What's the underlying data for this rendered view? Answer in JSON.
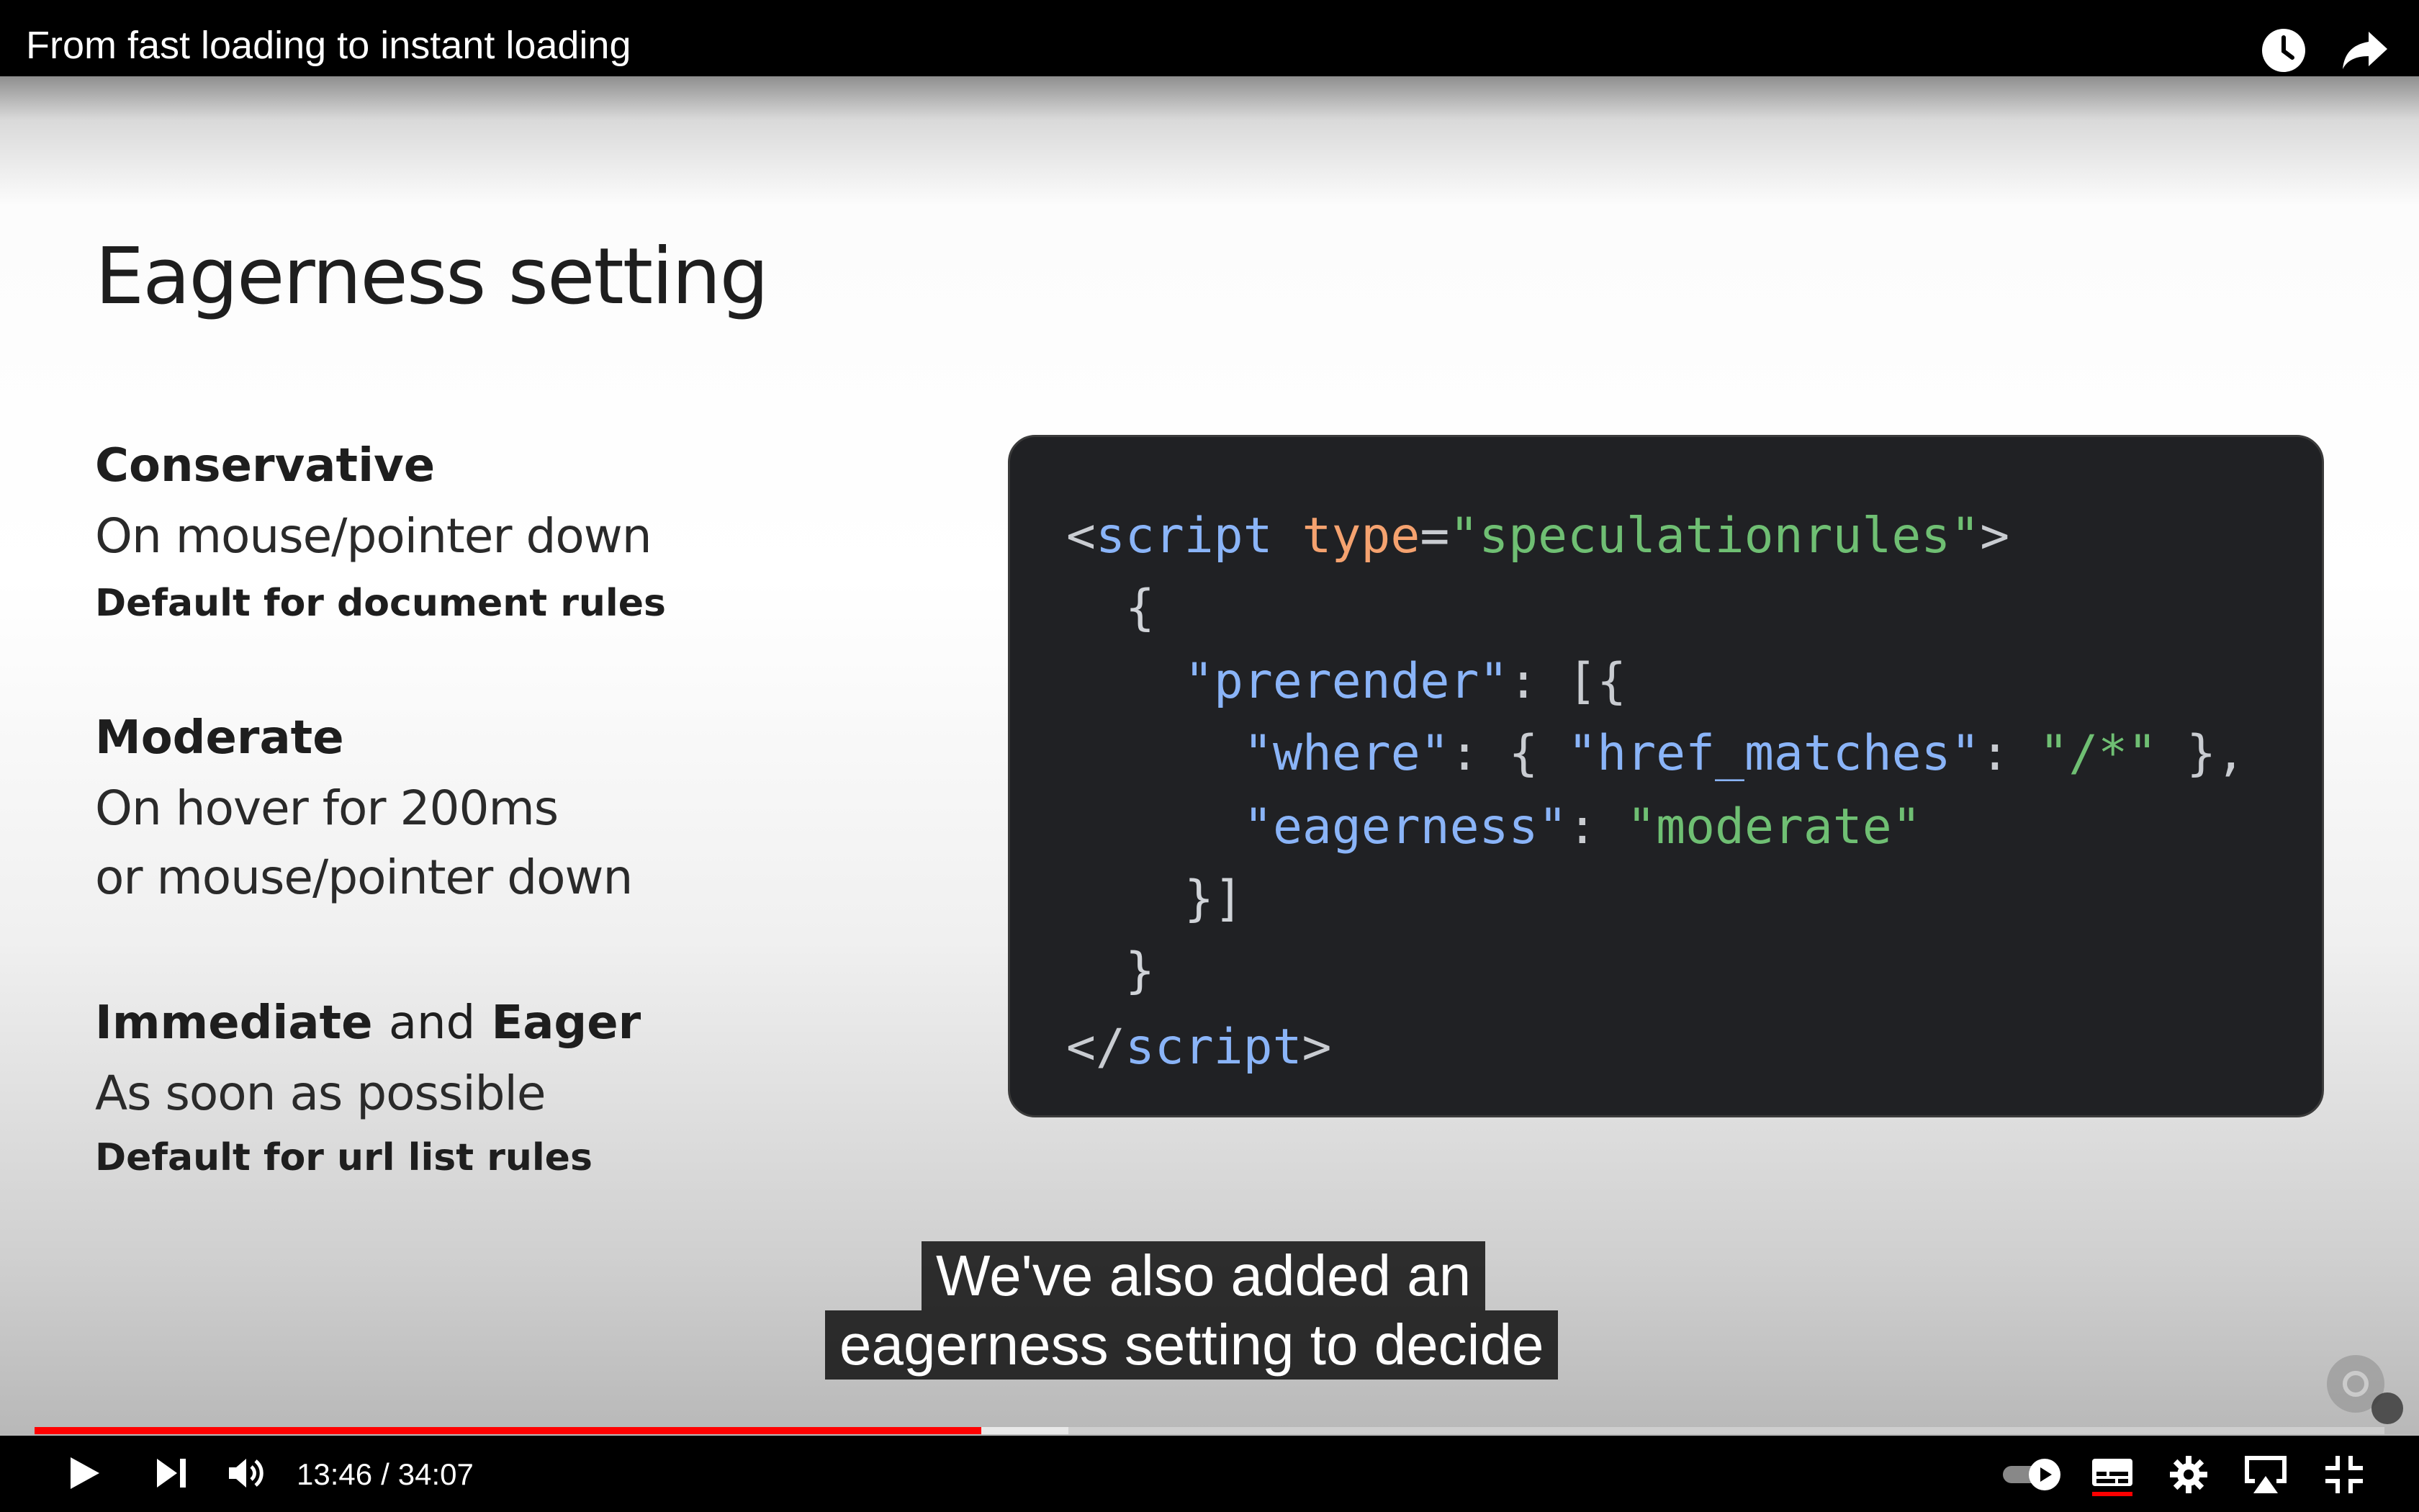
{
  "video": {
    "title": "From fast loading to instant loading",
    "current_time": "13:46",
    "duration": "34:07",
    "progress": 0.403,
    "buffered": 0.44
  },
  "slide": {
    "title": "Eagerness setting",
    "sections": [
      {
        "heading": "Conservative",
        "lines": [
          "On mouse/pointer down"
        ],
        "note": "Default for document rules"
      },
      {
        "heading": "Moderate",
        "lines": [
          "On hover for 200ms",
          "or mouse/pointer down"
        ],
        "note": ""
      },
      {
        "heading_a": "Immediate",
        "heading_and": "and",
        "heading_b": "Eager",
        "lines": [
          "As soon as possible"
        ],
        "note": "Default for url list rules"
      }
    ],
    "code": {
      "l1_open": "<",
      "l1_tag": "script",
      "l1_attr": "type",
      "l1_eq": "=",
      "l1_val": "\"speculationrules\"",
      "l1_close": ">",
      "l2": "{",
      "l3_key": "\"prerender\"",
      "l3_rest": ": [{",
      "l4_key": "\"where\"",
      "l4_mid": ": { ",
      "l4_key2": "\"href_matches\"",
      "l4_colon": ": ",
      "l4_val": "\"/*\"",
      "l4_end": " },",
      "l5_key": "\"eagerness\"",
      "l5_colon": ": ",
      "l5_val": "\"moderate\"",
      "l6": "}]",
      "l7": "}",
      "l8_open": "</",
      "l8_tag": "script",
      "l8_close": ">"
    }
  },
  "captions": {
    "line1": "We've also added an",
    "line2": "eagerness setting to decide"
  },
  "icons": {
    "top": [
      "clock-icon",
      "share-icon"
    ],
    "controls": [
      "play-icon",
      "next-icon",
      "volume-icon",
      "autoplay-toggle-icon",
      "subtitles-icon",
      "settings-icon",
      "airplay-icon",
      "exit-fullscreen-icon"
    ]
  },
  "colors": {
    "progress": "#ff0000",
    "code_bg": "#202124",
    "code_tag": "#8ab4f8",
    "code_attr": "#f5a26f",
    "code_string": "#6fbf73"
  }
}
